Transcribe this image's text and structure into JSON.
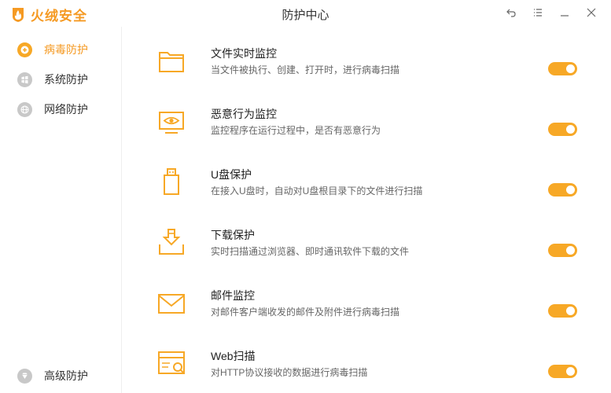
{
  "app": {
    "name": "火绒安全",
    "window_title": "防护中心",
    "accent": "#f7a826"
  },
  "window_controls": [
    {
      "icon": "back-icon"
    },
    {
      "icon": "menu-icon"
    },
    {
      "icon": "minimize-icon"
    },
    {
      "icon": "close-icon"
    }
  ],
  "sidebar": {
    "items": [
      {
        "label": "病毒防护",
        "icon": "shield-plus-icon",
        "active": true
      },
      {
        "label": "系统防护",
        "icon": "windows-icon",
        "active": false
      },
      {
        "label": "网络防护",
        "icon": "globe-icon",
        "active": false
      }
    ],
    "bottom_item": {
      "label": "高级防护",
      "icon": "diamond-icon"
    }
  },
  "main": {
    "rows": [
      {
        "title": "文件实时监控",
        "desc": "当文件被执行、创建、打开时，进行病毒扫描",
        "icon": "folder-icon",
        "enabled": true
      },
      {
        "title": "恶意行为监控",
        "desc": "监控程序在运行过程中，是否有恶意行为",
        "icon": "monitor-eye-icon",
        "enabled": true
      },
      {
        "title": "U盘保护",
        "desc": "在接入U盘时，自动对U盘根目录下的文件进行扫描",
        "icon": "usb-drive-icon",
        "enabled": true
      },
      {
        "title": "下载保护",
        "desc": "实时扫描通过浏览器、即时通讯软件下载的文件",
        "icon": "download-tray-icon",
        "enabled": true
      },
      {
        "title": "邮件监控",
        "desc": "对邮件客户端收发的邮件及附件进行病毒扫描",
        "icon": "mail-icon",
        "enabled": true
      },
      {
        "title": "Web扫描",
        "desc": "对HTTP协议接收的数据进行病毒扫描",
        "icon": "web-scan-icon",
        "enabled": true
      }
    ]
  }
}
